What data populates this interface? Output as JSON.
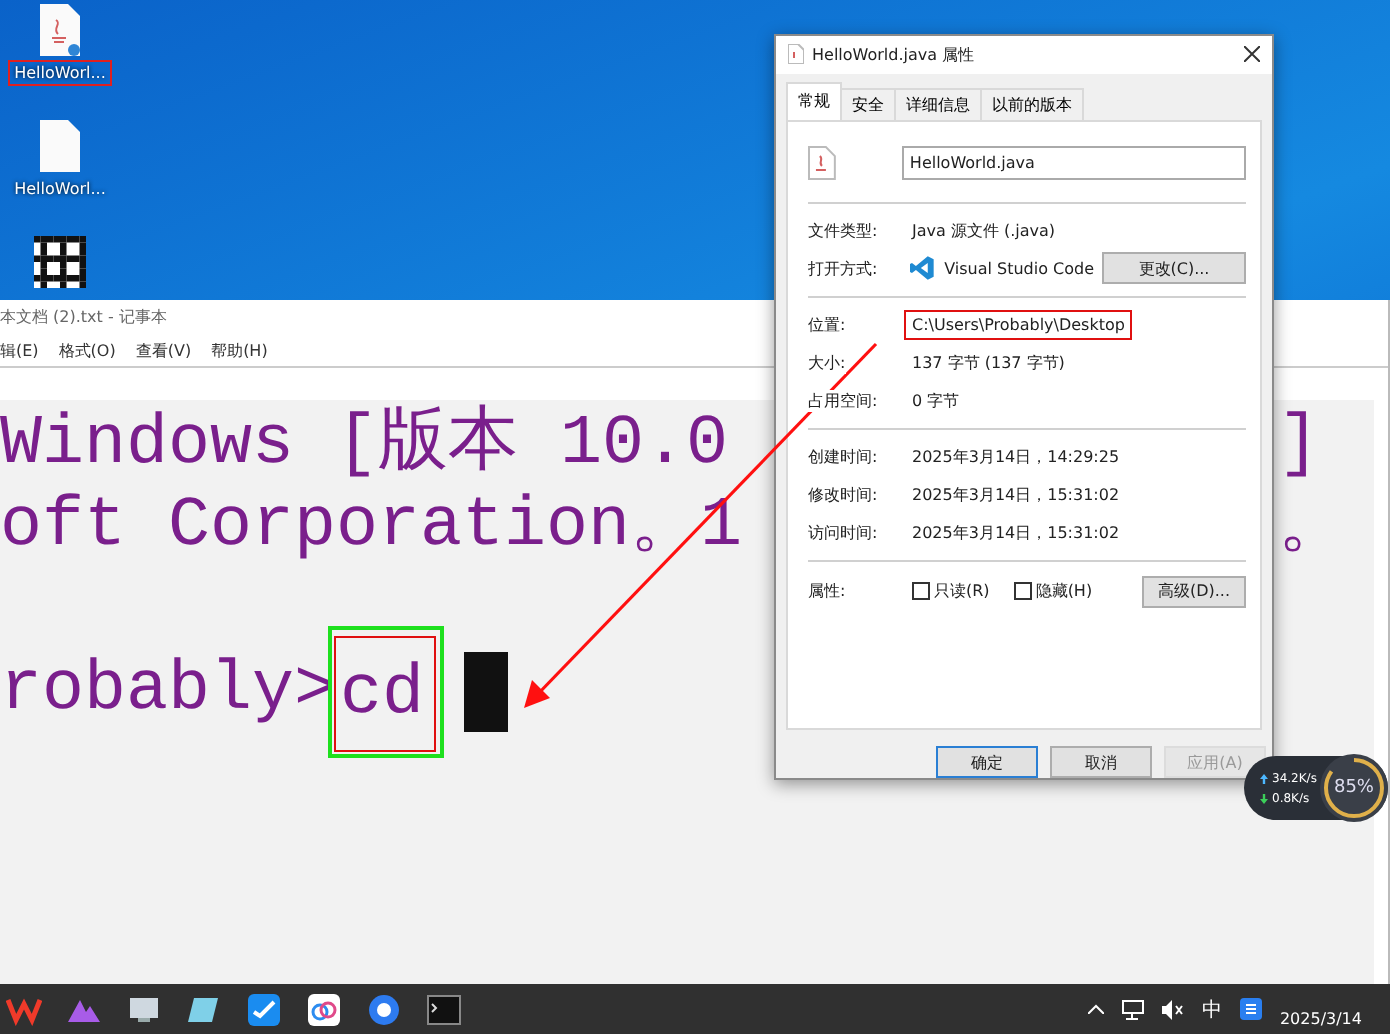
{
  "desktop": {
    "icons": [
      {
        "kind": "java",
        "label": "HelloWorl...",
        "highlighted": true
      },
      {
        "kind": "file",
        "label": "HelloWorl...",
        "highlighted": false
      },
      {
        "kind": "qr"
      }
    ]
  },
  "notepad": {
    "title": "本文档 (2).txt - 记事本",
    "menu": [
      "辑(E)",
      "格式(O)",
      "查看(V)",
      "帮助(H)"
    ],
    "lines": [
      {
        "kind": "text",
        "text": "Windows [版本 10.0",
        "tail": "]"
      },
      {
        "kind": "text",
        "text": "oft Corporation。1",
        "tail": "。"
      },
      {
        "kind": "blank"
      },
      {
        "kind": "prompt",
        "text": "robably>",
        "command": "cd",
        "cursor": true
      }
    ]
  },
  "dialog": {
    "title": "HelloWorld.java 属性",
    "tabs": [
      {
        "label": "常规",
        "selected": true
      },
      {
        "label": "安全",
        "selected": false
      },
      {
        "label": "详细信息",
        "selected": false
      },
      {
        "label": "以前的版本",
        "selected": false
      }
    ],
    "file_name": "HelloWorld.java",
    "sections": [
      [
        {
          "kind": "text",
          "label": "文件类型:",
          "value": "Java 源文件 (.java)",
          "highlighted": false
        },
        {
          "kind": "app",
          "label": "打开方式:",
          "value": "Visual Studio Code",
          "button": "更改(C)...",
          "highlighted": false
        }
      ],
      [
        {
          "kind": "text",
          "label": "位置:",
          "value": "C:\\Users\\Probably\\Desktop",
          "highlighted": true
        },
        {
          "kind": "text",
          "label": "大小:",
          "value": "137 字节 (137 字节)",
          "highlighted": false
        },
        {
          "kind": "text",
          "label": "占用空间:",
          "value": "0 字节",
          "highlighted": false
        }
      ],
      [
        {
          "kind": "text",
          "label": "创建时间:",
          "value": "2025年3月14日，14:29:25",
          "highlighted": false
        },
        {
          "kind": "text",
          "label": "修改时间:",
          "value": "2025年3月14日，15:31:02",
          "highlighted": false
        },
        {
          "kind": "text",
          "label": "访问时间:",
          "value": "2025年3月14日，15:31:02",
          "highlighted": false
        }
      ]
    ],
    "attributes_label": "属性:",
    "attributes": [
      {
        "label": "只读(R)",
        "checked": false
      },
      {
        "label": "隐藏(H)",
        "checked": false
      }
    ],
    "advanced_button": "高级(D)...",
    "buttons": [
      {
        "label": "确定",
        "default": true,
        "disabled": false
      },
      {
        "label": "取消",
        "default": false,
        "disabled": false
      },
      {
        "label": "应用(A)",
        "default": false,
        "disabled": true
      }
    ]
  },
  "net_widget": {
    "upload": "34.2K/s",
    "download": "0.8K/s",
    "load": "85%",
    "level": 0.85
  },
  "taskbar": {
    "ime": "中",
    "date": "2025/3/14"
  }
}
